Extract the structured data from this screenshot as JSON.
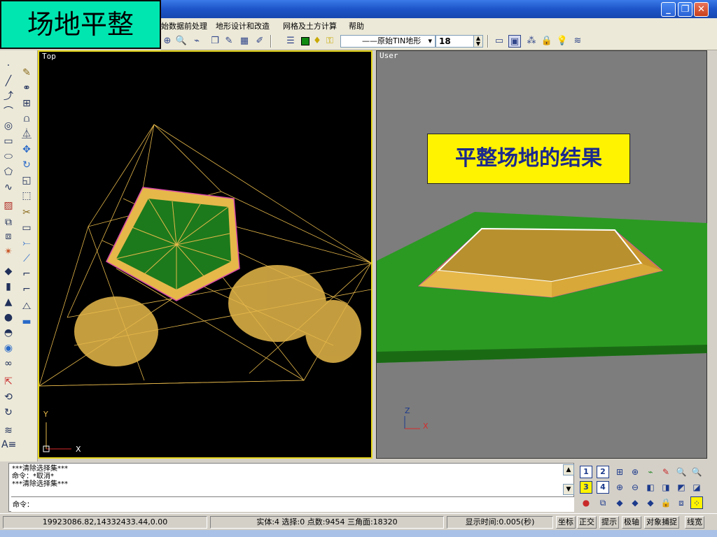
{
  "slide_title": "场地平整",
  "window": {
    "minimize": "_",
    "maximize": "❐",
    "close": "✕"
  },
  "menu": [
    {
      "label": "始数据前处理"
    },
    {
      "label": "地形设计和改造"
    },
    {
      "label": "网格及土方计算"
    },
    {
      "label": "帮助"
    }
  ],
  "toolbar": {
    "layer_name": "——原始TIN地形",
    "layer_dropdown": "▾",
    "text_size": "18",
    "text_size_dropdown": "▾"
  },
  "viewports": {
    "top": {
      "label": "Top",
      "axis_y": "Y",
      "axis_x": "X"
    },
    "user": {
      "label": "User",
      "axis_z": "Z",
      "axis_x": "X",
      "callout": "平整场地的结果"
    }
  },
  "command": {
    "history": [
      "***清除选择集***",
      "命令：*取消*",
      "***清除选择集***"
    ],
    "prompt": "命令："
  },
  "viewport_numbers": [
    "1",
    "2",
    "3",
    "4"
  ],
  "status": {
    "coords": "19923086.82,14332433.44,0.00",
    "entities": "实体:4 选择:0 点数:9454 三角面:18320",
    "display_time": "显示时间:0.005(秒)",
    "toggles": [
      "坐标",
      "正交",
      "提示",
      "极轴",
      "对象捕捉",
      "线宽"
    ]
  },
  "colors": {
    "accent_title": "#00e6b0",
    "callout_bg": "#fff300",
    "mesh": "#e6b84a",
    "terrain": "#2b9a22"
  }
}
